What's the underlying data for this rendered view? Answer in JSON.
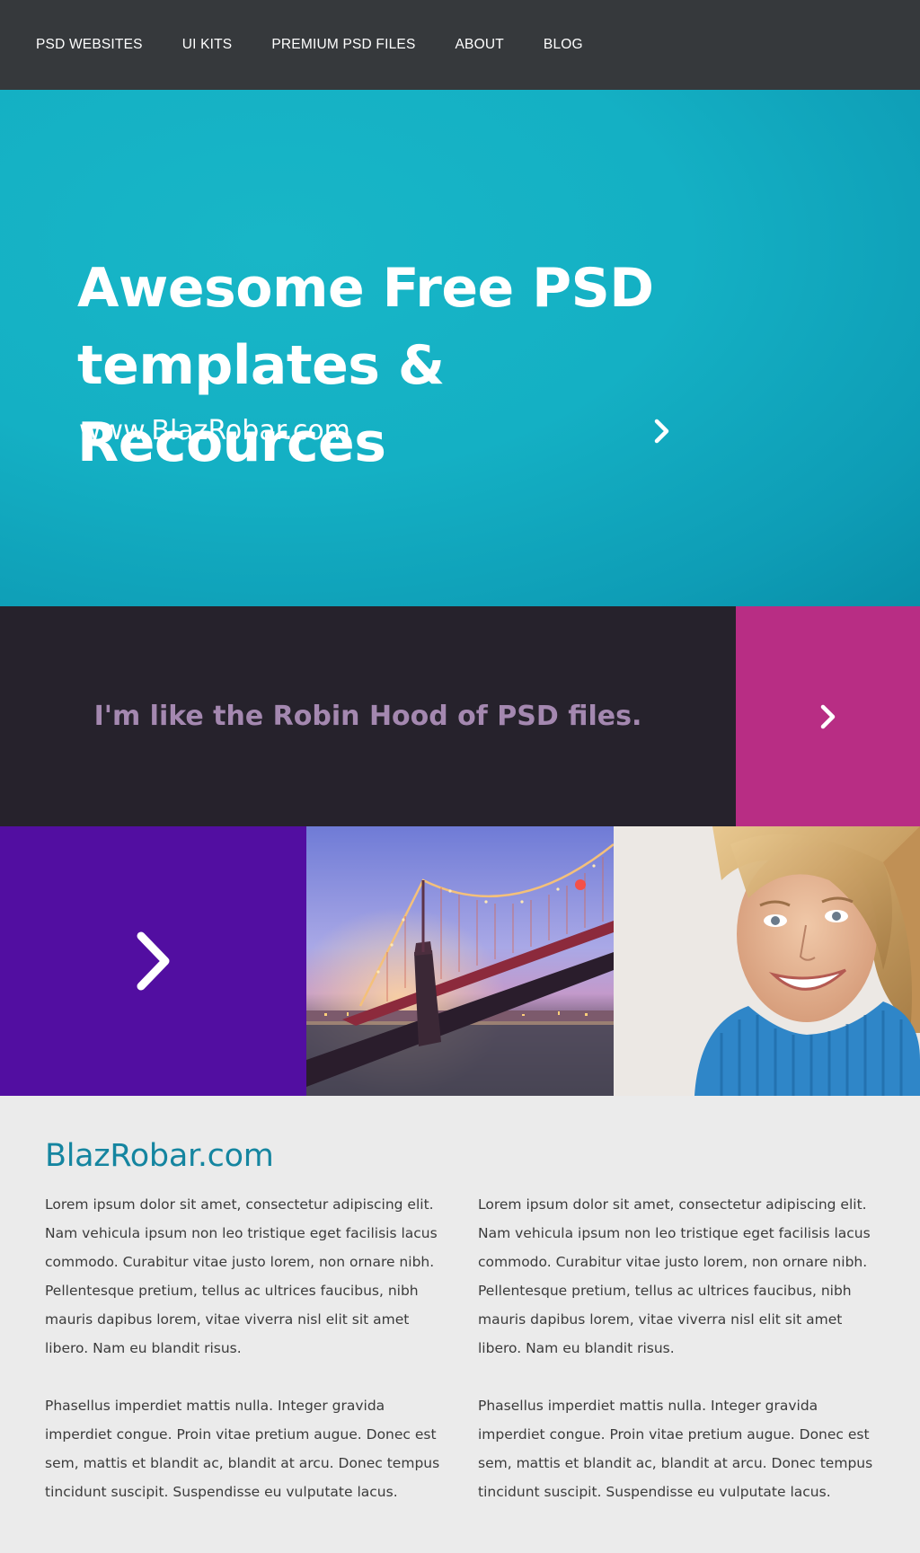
{
  "nav": {
    "items": [
      {
        "label": "PSD WEBSITES"
      },
      {
        "label": "UI KITS"
      },
      {
        "label": "PREMIUM PSD FILES"
      },
      {
        "label": "ABOUT"
      },
      {
        "label": "BLOG"
      }
    ]
  },
  "hero": {
    "title_line1": "Awesome Free PSD",
    "title_line2": "templates & Recources",
    "url": "www.BlazRobar.com",
    "arrow_icon": "chevron-right-icon"
  },
  "quote": {
    "text": "I'm like the Robin Hood of PSD files.",
    "cta_icon": "chevron-right-icon"
  },
  "tiles": {
    "purple_icon": "chevron-right-icon",
    "image1": "bridge-at-dusk",
    "image2": "smiling-woman-blue-sweater"
  },
  "content": {
    "title": "BlazRobar.com",
    "columns": [
      {
        "p1": "Lorem ipsum dolor sit amet, consectetur adipiscing elit. Nam vehicula ipsum non leo tristique eget facilisis lacus commodo. Curabitur vitae justo lorem, non ornare nibh. Pellentesque pretium, tellus ac ultrices faucibus, nibh mauris dapibus lorem, vitae viverra nisl elit sit amet libero. Nam eu blandit risus.",
        "p2": "Phasellus imperdiet mattis nulla. Integer gravida imperdiet congue. Proin vitae pretium augue. Donec est sem, mattis et blandit ac, blandit at arcu. Donec tempus tincidunt suscipit. Suspendisse eu vulputate lacus."
      },
      {
        "p1": "Lorem ipsum dolor sit amet, consectetur adipiscing elit. Nam vehicula ipsum non leo tristique eget facilisis lacus commodo. Curabitur vitae justo lorem, non ornare nibh. Pellentesque pretium, tellus ac ultrices faucibus, nibh mauris dapibus lorem, vitae viverra nisl elit sit amet libero. Nam eu blandit risus.",
        "p2": "Phasellus imperdiet mattis nulla. Integer gravida imperdiet congue. Proin vitae pretium augue. Donec est sem, mattis et blandit ac, blandit at arcu. Donec tempus tincidunt suscipit. Suspendisse eu vulputate lacus."
      }
    ]
  },
  "colors": {
    "nav_bg": "#36393c",
    "hero_bg": "#14b0c4",
    "quote_bg": "#26222c",
    "quote_text": "#a488b0",
    "cta_magenta": "#b82d84",
    "tile_purple": "#520ea1",
    "content_title": "#1585a0",
    "content_bg": "#ebebeb"
  }
}
